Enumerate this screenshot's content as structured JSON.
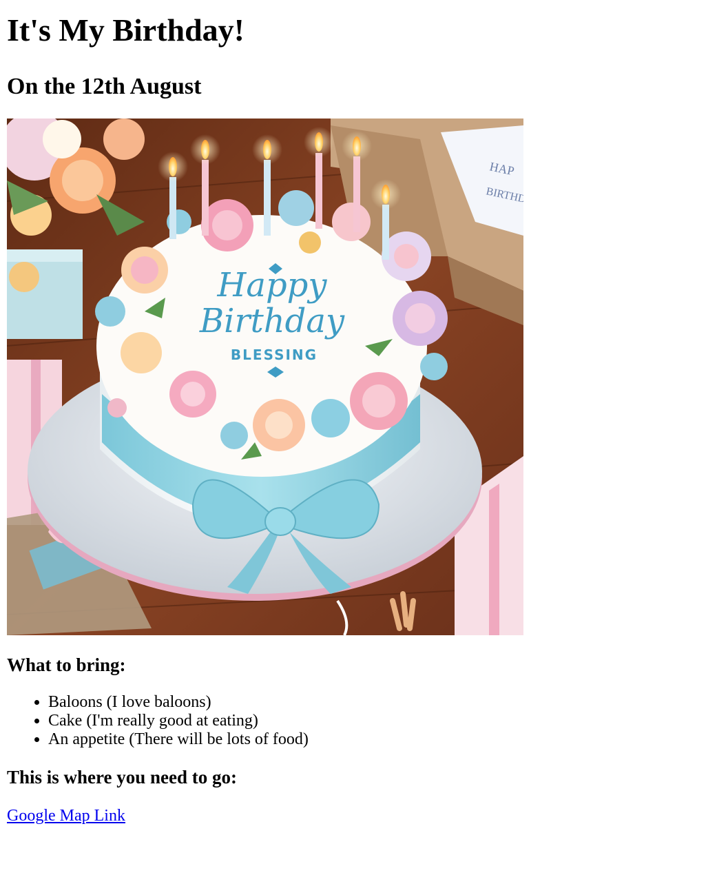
{
  "page": {
    "title": "It's My Birthday!",
    "subtitle": "On the 12th August"
  },
  "image": {
    "cake_text_line1": "Happy",
    "cake_text_line2": "Birthday",
    "cake_text_line3": "BLESSING",
    "card_text_1": "HAP",
    "card_text_2": "BIRTHD",
    "colors": {
      "table": "#7a3a1f",
      "frosting": "#fdfbf8",
      "ribbon": "#8fd3e0",
      "board": "#dfe4ea",
      "lettering": "#3f9cc4"
    }
  },
  "bring": {
    "heading": "What to bring:",
    "items": [
      "Baloons (I love baloons)",
      "Cake (I'm really good at eating)",
      "An appetite (There will be lots of food)"
    ]
  },
  "location": {
    "heading": "This is where you need to go:",
    "link_text": "Google Map Link"
  }
}
